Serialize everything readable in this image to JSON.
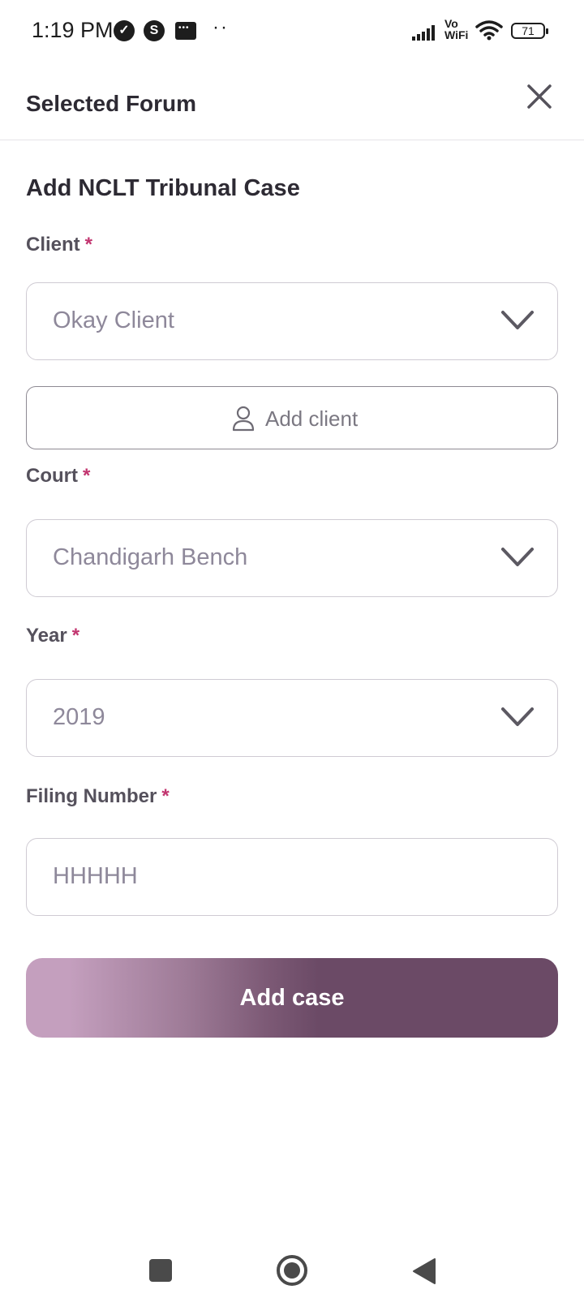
{
  "status_bar": {
    "time": "1:19 PM",
    "icons": [
      "check-circle-icon",
      "skype-icon",
      "message-icon"
    ],
    "dots": "··",
    "vowifi_top": "Vo",
    "vowifi_bottom": "WiFi",
    "battery": "71"
  },
  "header": {
    "title": "Selected Forum",
    "close_icon": "close-icon"
  },
  "form": {
    "title": "Add NCLT Tribunal Case",
    "client": {
      "label": "Client",
      "required": "*",
      "value": "Okay Client"
    },
    "add_client": {
      "label": "Add client",
      "icon": "user-icon"
    },
    "court": {
      "label": "Court",
      "required": "*",
      "value": "Chandigarh Bench"
    },
    "year": {
      "label": "Year",
      "required": "*",
      "value": "2019"
    },
    "filing_number": {
      "label": "Filing Number",
      "required": "*",
      "value": "HHHHH"
    },
    "submit_label": "Add case"
  },
  "nav_bar": {
    "icons": [
      "recents-icon",
      "home-icon",
      "back-icon"
    ]
  },
  "colors": {
    "required": "#c2356f",
    "button_start": "#c49fbe",
    "button_end": "#6b4a66",
    "placeholder": "#8e889a"
  }
}
